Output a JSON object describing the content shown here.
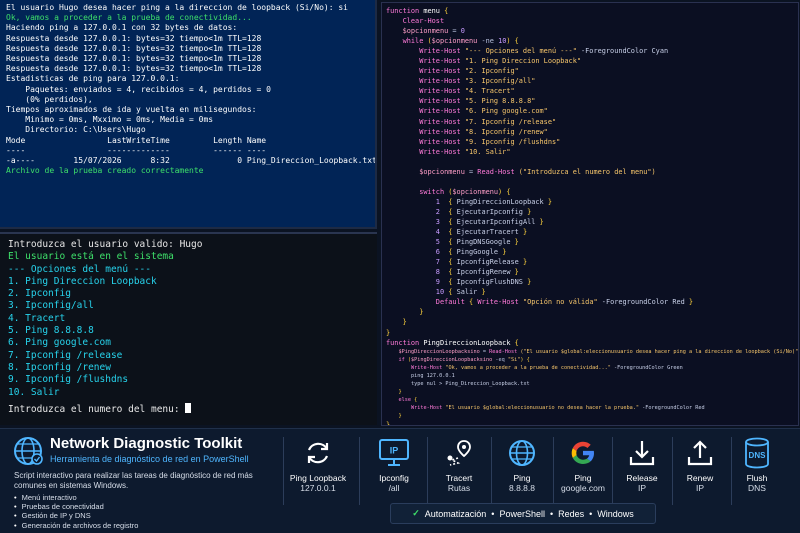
{
  "top_console": {
    "lines": [
      {
        "text": "El usuario Hugo desea hacer ping a la direccion de loopback (Si/No): si",
        "color": "white"
      },
      {
        "text": "Ok, vamos a proceder a la prueba de conectividad...",
        "color": "green"
      },
      {
        "text": "",
        "color": "white"
      },
      {
        "text": "Haciendo ping a 127.0.0.1 con 32 bytes de datos:",
        "color": "white"
      },
      {
        "text": "Respuesta desde 127.0.0.1: bytes=32 tiempo<1m TTL=128",
        "color": "white"
      },
      {
        "text": "Respuesta desde 127.0.0.1: bytes=32 tiempo<1m TTL=128",
        "color": "white"
      },
      {
        "text": "Respuesta desde 127.0.0.1: bytes=32 tiempo<1m TTL=128",
        "color": "white"
      },
      {
        "text": "Respuesta desde 127.0.0.1: bytes=32 tiempo<1m TTL=128",
        "color": "white"
      },
      {
        "text": "",
        "color": "white"
      },
      {
        "text": "Estadisticas de ping para 127.0.0.1:",
        "color": "white"
      },
      {
        "text": "    Paquetes: enviados = 4, recibidos = 4, perdidos = 0",
        "color": "white"
      },
      {
        "text": "    (0% perdidos),",
        "color": "white"
      },
      {
        "text": "Tiempos aproximados de ida y vuelta en milisegundos:",
        "color": "white"
      },
      {
        "text": "    Minimo = 0ms, Mxximo = 0ms, Media = 0ms",
        "color": "white"
      },
      {
        "text": "",
        "color": "white"
      },
      {
        "text": "",
        "color": "white"
      },
      {
        "text": "    Directorio: C:\\Users\\Hugo",
        "color": "white"
      },
      {
        "text": "",
        "color": "white"
      },
      {
        "text": "",
        "color": "white"
      },
      {
        "text": "Mode                 LastWriteTime         Length Name",
        "color": "white"
      },
      {
        "text": "----                 -------------         ------ ----",
        "color": "white"
      },
      {
        "text": "-a----        15/07/2026      8:32              0 Ping_Direccion_Loopback.txt",
        "color": "white"
      },
      {
        "text": "Archivo de la prueba creado correctamente",
        "color": "green"
      }
    ]
  },
  "menu_console": {
    "lines": [
      {
        "text": "Introduzca el usuario valido: Hugo",
        "color": "white"
      },
      {
        "text": "El usuario está en el sistema",
        "color": "green"
      },
      {
        "text": "--- Opciones del menú ---",
        "color": "cyan"
      },
      {
        "text": "1. Ping Direccion Loopback",
        "color": "cyan"
      },
      {
        "text": "2. Ipconfig",
        "color": "cyan"
      },
      {
        "text": "3. Ipconfig/all",
        "color": "cyan"
      },
      {
        "text": "4. Tracert",
        "color": "cyan"
      },
      {
        "text": "5. Ping 8.8.8.8",
        "color": "cyan"
      },
      {
        "text": "6. Ping google.com",
        "color": "cyan"
      },
      {
        "text": "7. Ipconfig /release",
        "color": "cyan"
      },
      {
        "text": "8. Ipconfig /renew",
        "color": "cyan"
      },
      {
        "text": "9. Ipconfig /flushdns",
        "color": "cyan"
      },
      {
        "text": "10. Salir",
        "color": "cyan"
      }
    ],
    "prompt": "Introduzca el numero del menu: "
  },
  "code_editor": {
    "lines": [
      {
        "size": "n",
        "segs": [
          [
            "kw",
            "function "
          ],
          [
            "fn",
            "menu "
          ],
          [
            "br",
            "{"
          ]
        ]
      },
      {
        "size": "n",
        "segs": [
          [
            "pl",
            "    "
          ],
          [
            "kw",
            "Clear-Host"
          ]
        ]
      },
      {
        "size": "n",
        "segs": [
          [
            "pl",
            "    "
          ],
          [
            "var",
            "$opcionmenu"
          ],
          [
            "op",
            " = "
          ],
          [
            "num",
            "0"
          ]
        ]
      },
      {
        "size": "n",
        "segs": [
          [
            "pl",
            "    "
          ],
          [
            "kw",
            "while "
          ],
          [
            "br",
            "("
          ],
          [
            "var",
            "$opcionmenu"
          ],
          [
            "op",
            " -ne "
          ],
          [
            "num",
            "10"
          ],
          [
            "br",
            ") {"
          ]
        ]
      },
      {
        "size": "n",
        "segs": [
          [
            "pl",
            "        "
          ],
          [
            "kw",
            "Write-Host "
          ],
          [
            "str",
            "\"--- Opciones del menú ---\""
          ],
          [
            "pl",
            " -ForegroundColor Cyan"
          ]
        ]
      },
      {
        "size": "n",
        "segs": [
          [
            "pl",
            "        "
          ],
          [
            "kw",
            "Write-Host "
          ],
          [
            "str",
            "\"1. Ping Direccion Loopback\""
          ]
        ]
      },
      {
        "size": "n",
        "segs": [
          [
            "pl",
            "        "
          ],
          [
            "kw",
            "Write-Host "
          ],
          [
            "str",
            "\"2. Ipconfig\""
          ]
        ]
      },
      {
        "size": "n",
        "segs": [
          [
            "pl",
            "        "
          ],
          [
            "kw",
            "Write-Host "
          ],
          [
            "str",
            "\"3. Ipconfig/all\""
          ]
        ]
      },
      {
        "size": "n",
        "segs": [
          [
            "pl",
            "        "
          ],
          [
            "kw",
            "Write-Host "
          ],
          [
            "str",
            "\"4. Tracert\""
          ]
        ]
      },
      {
        "size": "n",
        "segs": [
          [
            "pl",
            "        "
          ],
          [
            "kw",
            "Write-Host "
          ],
          [
            "str",
            "\"5. Ping 8.8.8.8\""
          ]
        ]
      },
      {
        "size": "n",
        "segs": [
          [
            "pl",
            "        "
          ],
          [
            "kw",
            "Write-Host "
          ],
          [
            "str",
            "\"6. Ping google.com\""
          ]
        ]
      },
      {
        "size": "n",
        "segs": [
          [
            "pl",
            "        "
          ],
          [
            "kw",
            "Write-Host "
          ],
          [
            "str",
            "\"7. Ipconfig /release\""
          ]
        ]
      },
      {
        "size": "n",
        "segs": [
          [
            "pl",
            "        "
          ],
          [
            "kw",
            "Write-Host "
          ],
          [
            "str",
            "\"8. Ipconfig /renew\""
          ]
        ]
      },
      {
        "size": "n",
        "segs": [
          [
            "pl",
            "        "
          ],
          [
            "kw",
            "Write-Host "
          ],
          [
            "str",
            "\"9. Ipconfig /flushdns\""
          ]
        ]
      },
      {
        "size": "n",
        "segs": [
          [
            "pl",
            "        "
          ],
          [
            "kw",
            "Write-Host "
          ],
          [
            "str",
            "\"10. Salir\""
          ]
        ]
      },
      {
        "size": "n",
        "segs": [
          [
            "pl",
            " "
          ]
        ]
      },
      {
        "size": "n",
        "segs": [
          [
            "pl",
            "        "
          ],
          [
            "var",
            "$opcionmenu"
          ],
          [
            "op",
            " = "
          ],
          [
            "kw",
            "Read-Host "
          ],
          [
            "str",
            "(\"Introduzca el numero del menu\")"
          ]
        ]
      },
      {
        "size": "n",
        "segs": [
          [
            "pl",
            " "
          ]
        ]
      },
      {
        "size": "n",
        "segs": [
          [
            "pl",
            "        "
          ],
          [
            "kw",
            "switch "
          ],
          [
            "br",
            "("
          ],
          [
            "var",
            "$opcionmenu"
          ],
          [
            "br",
            ") {"
          ]
        ]
      },
      {
        "size": "n",
        "segs": [
          [
            "pl",
            "            "
          ],
          [
            "num",
            "1"
          ],
          [
            "br",
            "  { "
          ],
          [
            "pl",
            "PingDireccionLoopback "
          ],
          [
            "br",
            "}"
          ]
        ]
      },
      {
        "size": "n",
        "segs": [
          [
            "pl",
            "            "
          ],
          [
            "num",
            "2"
          ],
          [
            "br",
            "  { "
          ],
          [
            "pl",
            "EjecutarIpconfig "
          ],
          [
            "br",
            "}"
          ]
        ]
      },
      {
        "size": "n",
        "segs": [
          [
            "pl",
            "            "
          ],
          [
            "num",
            "3"
          ],
          [
            "br",
            "  { "
          ],
          [
            "pl",
            "EjecutarIpconfigAll "
          ],
          [
            "br",
            "}"
          ]
        ]
      },
      {
        "size": "n",
        "segs": [
          [
            "pl",
            "            "
          ],
          [
            "num",
            "4"
          ],
          [
            "br",
            "  { "
          ],
          [
            "pl",
            "EjecutarTracert "
          ],
          [
            "br",
            "}"
          ]
        ]
      },
      {
        "size": "n",
        "segs": [
          [
            "pl",
            "            "
          ],
          [
            "num",
            "5"
          ],
          [
            "br",
            "  { "
          ],
          [
            "pl",
            "PingDNSGoogle "
          ],
          [
            "br",
            "}"
          ]
        ]
      },
      {
        "size": "n",
        "segs": [
          [
            "pl",
            "            "
          ],
          [
            "num",
            "6"
          ],
          [
            "br",
            "  { "
          ],
          [
            "pl",
            "PingGoogle "
          ],
          [
            "br",
            "}"
          ]
        ]
      },
      {
        "size": "n",
        "segs": [
          [
            "pl",
            "            "
          ],
          [
            "num",
            "7"
          ],
          [
            "br",
            "  { "
          ],
          [
            "pl",
            "IpconfigRelease "
          ],
          [
            "br",
            "}"
          ]
        ]
      },
      {
        "size": "n",
        "segs": [
          [
            "pl",
            "            "
          ],
          [
            "num",
            "8"
          ],
          [
            "br",
            "  { "
          ],
          [
            "pl",
            "IpconfigRenew "
          ],
          [
            "br",
            "}"
          ]
        ]
      },
      {
        "size": "n",
        "segs": [
          [
            "pl",
            "            "
          ],
          [
            "num",
            "9"
          ],
          [
            "br",
            "  { "
          ],
          [
            "pl",
            "IpconfigFlushDNS "
          ],
          [
            "br",
            "}"
          ]
        ]
      },
      {
        "size": "n",
        "segs": [
          [
            "pl",
            "            "
          ],
          [
            "num",
            "10"
          ],
          [
            "br",
            " { "
          ],
          [
            "pl",
            "Salir "
          ],
          [
            "br",
            "}"
          ]
        ]
      },
      {
        "size": "n",
        "segs": [
          [
            "pl",
            "            "
          ],
          [
            "kw",
            "Default "
          ],
          [
            "br",
            "{ "
          ],
          [
            "kw",
            "Write-Host "
          ],
          [
            "str",
            "\"Opción no válida\""
          ],
          [
            "pl",
            " -ForegroundColor Red "
          ],
          [
            "br",
            "}"
          ]
        ]
      },
      {
        "size": "n",
        "segs": [
          [
            "pl",
            "        "
          ],
          [
            "br",
            "}"
          ]
        ]
      },
      {
        "size": "n",
        "segs": [
          [
            "pl",
            "    "
          ],
          [
            "br",
            "}"
          ]
        ]
      },
      {
        "size": "n",
        "segs": [
          [
            "br",
            "}"
          ]
        ]
      },
      {
        "size": "n",
        "segs": [
          [
            "kw",
            "function "
          ],
          [
            "fn",
            "PingDireccionLoopback "
          ],
          [
            "br",
            "{"
          ]
        ]
      },
      {
        "size": "s",
        "segs": [
          [
            "pl",
            "    "
          ],
          [
            "var",
            "$PingDireccionLoopbacksino"
          ],
          [
            "op",
            " = "
          ],
          [
            "kw",
            "Read-Host "
          ],
          [
            "str",
            "(\"El usuario $global:eleccionusuario desea hacer ping a la direccion de loopback (Si/No)\")"
          ]
        ]
      },
      {
        "size": "s",
        "segs": [
          [
            "pl",
            "    "
          ],
          [
            "kw",
            "if "
          ],
          [
            "br",
            "("
          ],
          [
            "var",
            "$PingDireccionLoopbacksino"
          ],
          [
            "op",
            " -eq "
          ],
          [
            "str",
            "\"Si\""
          ],
          [
            "br",
            ") {"
          ]
        ]
      },
      {
        "size": "s",
        "segs": [
          [
            "pl",
            "        "
          ],
          [
            "kw",
            "Write-Host "
          ],
          [
            "str",
            "\"Ok, vamos a proceder a la prueba de conectividad...\""
          ],
          [
            "pl",
            " -ForegroundColor Green"
          ]
        ]
      },
      {
        "size": "s",
        "segs": [
          [
            "pl",
            "        ping 127.0.0.1"
          ]
        ]
      },
      {
        "size": "s",
        "segs": [
          [
            "pl",
            "        type nul > Ping_Direccion_Loopback.txt"
          ]
        ]
      },
      {
        "size": "s",
        "segs": [
          [
            "pl",
            "    "
          ],
          [
            "br",
            "}"
          ]
        ]
      },
      {
        "size": "s",
        "segs": [
          [
            "pl",
            "    "
          ],
          [
            "kw",
            "else "
          ],
          [
            "br",
            "{"
          ]
        ]
      },
      {
        "size": "s",
        "segs": [
          [
            "pl",
            "        "
          ],
          [
            "kw",
            "Write-Host "
          ],
          [
            "str",
            "\"El usuario $global:eleccionusuario no desea hacer la prueba.\""
          ],
          [
            "pl",
            " -ForegroundColor Red"
          ]
        ]
      },
      {
        "size": "s",
        "segs": [
          [
            "pl",
            "    "
          ],
          [
            "br",
            "}"
          ]
        ]
      },
      {
        "size": "n",
        "segs": [
          [
            "br",
            "}"
          ]
        ]
      }
    ]
  },
  "banner": {
    "title": "Network Diagnostic Toolkit",
    "subtitle": "Herramienta de diagnóstico de red en PowerShell",
    "description": "Script interactivo para realizar las tareas de diagnóstico de red más comunes en sistemas Windows.",
    "features": [
      "Menú interactivo",
      "Pruebas de conectividad",
      "Gestión de IP y DNS",
      "Generación de archivos de registro"
    ],
    "tools": [
      {
        "name": "loopback-tool",
        "icon": "refresh-icon",
        "line1": "Ping Loopback",
        "line2": "127.0.0.1"
      },
      {
        "name": "ipconfig-tool",
        "icon": "ip-monitor-icon",
        "line1": "Ipconfig",
        "line2": "/all"
      },
      {
        "name": "tracert-tool",
        "icon": "route-pin-icon",
        "line1": "Tracert",
        "line2": "Rutas"
      },
      {
        "name": "ping-dns-tool",
        "icon": "globe-icon",
        "line1": "Ping",
        "line2": "8.8.8.8"
      },
      {
        "name": "ping-google-tool",
        "icon": "google-icon",
        "line1": "Ping",
        "line2": "google.com"
      },
      {
        "name": "release-tool",
        "icon": "download-icon",
        "line1": "Release",
        "line2": "IP"
      },
      {
        "name": "renew-tool",
        "icon": "upload-icon",
        "line1": "Renew",
        "line2": "IP"
      },
      {
        "name": "flush-dns-tool",
        "icon": "dns-database-icon",
        "line1": "Flush",
        "line2": "DNS"
      }
    ],
    "tags": [
      "Automatización",
      "PowerShell",
      "Redes",
      "Windows"
    ],
    "icon_badge_text": "IP",
    "dns_badge_text": "DNS",
    "google_letter": "G",
    "colors": {
      "accent": "#4fb6ff",
      "green": "#3ee06a",
      "cyan": "#27d3ec",
      "console_bg": "#012456"
    }
  }
}
